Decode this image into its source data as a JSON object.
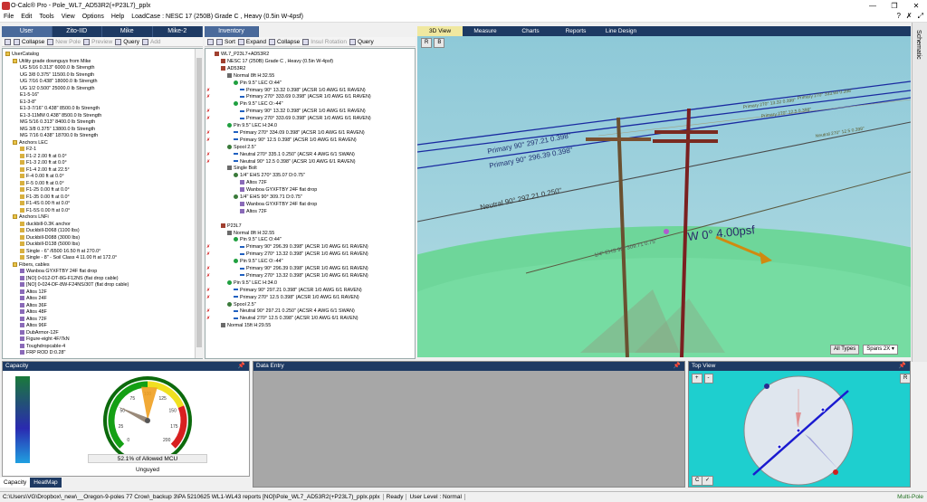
{
  "window": {
    "title": "O-Calc® Pro - Pole_WL7_AD53R2(+P23L7)_pplx",
    "controls": [
      "—",
      "❐",
      "✕"
    ]
  },
  "menu": {
    "items": [
      "File",
      "Edit",
      "Tools",
      "View",
      "Options",
      "Help"
    ],
    "loadcase": "LoadCase : NESC 17 (250B) Grade C , Heavy (0.5in W-4psf)",
    "right": [
      "?",
      "✗",
      "⤢"
    ]
  },
  "catalog": {
    "tabs": [
      "User",
      "Zito-IID",
      "Mike",
      "Mike-2"
    ],
    "toolbar": {
      "collapse": "Collapse",
      "newpole": "New Pole",
      "preview": "Preview",
      "query": "Query",
      "add": "Add"
    },
    "rows": [
      {
        "t": "UserCatalog",
        "lvl": 0,
        "ic": "folder"
      },
      {
        "t": "Utility grade downguys from Mike",
        "lvl": 1,
        "ic": "folder"
      },
      {
        "t": "UG 5/16  0.313\"  6000.0 lb Strength",
        "lvl": 2,
        "ic": ""
      },
      {
        "t": "UG 3/8  0.375\"  11500.0 lb Strength",
        "lvl": 2,
        "ic": ""
      },
      {
        "t": "UG 7/16  0.438\"  18000.0 lb Strength",
        "lvl": 2,
        "ic": ""
      },
      {
        "t": "UG 1/2  0.500\"  25000.0 lb Strength",
        "lvl": 2,
        "ic": ""
      },
      {
        "t": "E1-5-16\"",
        "lvl": 2,
        "ic": ""
      },
      {
        "t": "E1-3-8\"",
        "lvl": 2,
        "ic": ""
      },
      {
        "t": "E1-3-7/16\"  0.438\"  8500.0 lb Strength",
        "lvl": 2,
        "ic": ""
      },
      {
        "t": "E1-3-11MM  0.438\"  8500.0 lb Strength",
        "lvl": 2,
        "ic": ""
      },
      {
        "t": "MG 5/16  0.313\"  8400.0 lb Strength",
        "lvl": 2,
        "ic": ""
      },
      {
        "t": "MG 3/8  0.375\"  13800.0 lb Strength",
        "lvl": 2,
        "ic": ""
      },
      {
        "t": "MG 7/16  0.438\"  18700.0 lb Strength",
        "lvl": 2,
        "ic": ""
      },
      {
        "t": "Anchors LEC",
        "lvl": 1,
        "ic": "folder"
      },
      {
        "t": "F2-1",
        "lvl": 2,
        "ic": "anchor"
      },
      {
        "t": "F1-2 2.00 ft at 0.0°",
        "lvl": 2,
        "ic": "anchor"
      },
      {
        "t": "F1-3 2.00 ft at 0.0°",
        "lvl": 2,
        "ic": "anchor"
      },
      {
        "t": "F1-4 2.00 ft at 22.5°",
        "lvl": 2,
        "ic": "anchor"
      },
      {
        "t": "F-4 0.00 ft at 0.0°",
        "lvl": 2,
        "ic": "anchor"
      },
      {
        "t": "F-5 0.00 ft at 0.0°",
        "lvl": 2,
        "ic": "anchor"
      },
      {
        "t": "F1-25 0.00 ft at 0.0°",
        "lvl": 2,
        "ic": "anchor"
      },
      {
        "t": "F1-35 0.00 ft at 0.0°",
        "lvl": 2,
        "ic": "anchor"
      },
      {
        "t": "F1-4S 0.00 ft at 0.0°",
        "lvl": 2,
        "ic": "anchor"
      },
      {
        "t": "F1-5S 0.00 ft at 0.0°",
        "lvl": 2,
        "ic": "anchor"
      },
      {
        "t": "Anchors LNFi",
        "lvl": 1,
        "ic": "folder"
      },
      {
        "t": "duckbill-0.3K anchor",
        "lvl": 2,
        "ic": "anchor"
      },
      {
        "t": "Duckbill-D068 (1100 lbs)",
        "lvl": 2,
        "ic": "anchor"
      },
      {
        "t": "Duckbill-D088 (3000 lbs)",
        "lvl": 2,
        "ic": "anchor"
      },
      {
        "t": "Duckbill-D138 (5000 lbs)",
        "lvl": 2,
        "ic": "anchor"
      },
      {
        "t": "Single - 6\" /6500 16.50 ft at 270.0°",
        "lvl": 2,
        "ic": "anchor"
      },
      {
        "t": "Single - 8\" - Soil Class 4 11.00 ft at 172.0°",
        "lvl": 2,
        "ic": "anchor"
      },
      {
        "t": "Fibers, cables",
        "lvl": 1,
        "ic": "folder"
      },
      {
        "t": "Wanboa GYXFTBY 24F flat drop",
        "lvl": 2,
        "ic": "fiber"
      },
      {
        "t": "[NO] 0-012-DT-8G-F12NS (flat drop cable)",
        "lvl": 2,
        "ic": "fiber"
      },
      {
        "t": "[NO] 0-024-DF-8W-F24NS/30T (flat drop cable)",
        "lvl": 2,
        "ic": "fiber"
      },
      {
        "t": "Altos 12F",
        "lvl": 2,
        "ic": "fiber"
      },
      {
        "t": "Altos 24F",
        "lvl": 2,
        "ic": "fiber"
      },
      {
        "t": "Altos 36F",
        "lvl": 2,
        "ic": "fiber"
      },
      {
        "t": "Altos 48F",
        "lvl": 2,
        "ic": "fiber"
      },
      {
        "t": "Altos 72F",
        "lvl": 2,
        "ic": "fiber"
      },
      {
        "t": "Altos 96F",
        "lvl": 2,
        "ic": "fiber"
      },
      {
        "t": "DubArmor-12F",
        "lvl": 2,
        "ic": "fiber"
      },
      {
        "t": "Figure-eight 4F/7kN",
        "lvl": 2,
        "ic": "fiber"
      },
      {
        "t": "Toughdropcable-4",
        "lvl": 2,
        "ic": "fiber"
      },
      {
        "t": "FRP ROD  D:0.28\"",
        "lvl": 2,
        "ic": "fiber"
      }
    ]
  },
  "inventory": {
    "tabs": [
      "Inventory"
    ],
    "toolbar": {
      "sort": "Sort",
      "expand": "Expand",
      "collapse": "Collapse",
      "insul": "Insul Rotation",
      "query": "Query"
    },
    "rows": [
      {
        "t": "WL7_P23L7+AD53R2",
        "lvl": 0,
        "ic": "pole"
      },
      {
        "t": "NESC  17 (250B) Grade C , Heavy (0.5in W-4psf)",
        "lvl": 1,
        "ic": "pole"
      },
      {
        "t": "AD53R2",
        "lvl": 1,
        "ic": "pole"
      },
      {
        "t": "Normal 8ft  H:32.55",
        "lvl": 2,
        "ic": "bolt"
      },
      {
        "t": "Pin 9.5\"  LEC  O:44\"",
        "lvl": 3,
        "ic": "pin"
      },
      {
        "t": "Primary 90°  13.32  0.398\"   (ACSR 1/0  AWG 6/1 RAVEN)",
        "lvl": 4,
        "ic": "wire"
      },
      {
        "t": "Primary 270°  333.69  0.398\"   (ACSR 1/0  AWG 6/1 RAVEN)",
        "lvl": 4,
        "ic": "wire"
      },
      {
        "t": "Pin 9.5\"  LEC  O:-44\"",
        "lvl": 3,
        "ic": "pin"
      },
      {
        "t": "Primary 90°  13.32  0.398\"   (ACSR 1/0  AWG 6/1 RAVEN)",
        "lvl": 4,
        "ic": "wire"
      },
      {
        "t": "Primary 270°  333.69  0.398\"   (ACSR 1/0  AWG 6/1 RAVEN)",
        "lvl": 4,
        "ic": "wire"
      },
      {
        "t": "Pin 9.5\"  LEC  H:34.0",
        "lvl": 2,
        "ic": "pin"
      },
      {
        "t": "Primary 270°  334.09  0.398\"   (ACSR 1/0  AWG 6/1 RAVEN)",
        "lvl": 3,
        "ic": "wire"
      },
      {
        "t": "Primary 90°  12.5  0.398\"   (ACSR 1/0  AWG 6/1 RAVEN)",
        "lvl": 3,
        "ic": "wire"
      },
      {
        "t": "Spool 2.5\"",
        "lvl": 2,
        "ic": "spool"
      },
      {
        "t": "Neutral 270°  335.1  0.250\"   (ACSR 4 AWG 6/1 SWAN)",
        "lvl": 3,
        "ic": "wire"
      },
      {
        "t": "Neutral 90°  12.5  0.398\"   (ACSR 1/0  AWG 6/1 RAVEN)",
        "lvl": 3,
        "ic": "wire"
      },
      {
        "t": "Single Bolt",
        "lvl": 2,
        "ic": "bolt"
      },
      {
        "t": "1/4\"  EHS 270°  335.07  D:0.75\"",
        "lvl": 3,
        "ic": "spool"
      },
      {
        "t": "Altos 72F",
        "lvl": 4,
        "ic": "fiber"
      },
      {
        "t": "Wanboa GYXFTBY 24F flat drop",
        "lvl": 4,
        "ic": "fiber"
      },
      {
        "t": "1/4\"  EHS 90°  309.71  D:0.75\"",
        "lvl": 3,
        "ic": "spool"
      },
      {
        "t": "Wanboa GYXFTBY 24F flat drop",
        "lvl": 4,
        "ic": "fiber"
      },
      {
        "t": "Altos 72F",
        "lvl": 4,
        "ic": "fiber"
      },
      {
        "t": "",
        "lvl": 0,
        "ic": ""
      },
      {
        "t": "P23L7",
        "lvl": 1,
        "ic": "pole"
      },
      {
        "t": "Normal 8ft  H:32.55",
        "lvl": 2,
        "ic": "bolt"
      },
      {
        "t": "Pin 9.5\"  LEC  O:44\"",
        "lvl": 3,
        "ic": "pin"
      },
      {
        "t": "Primary 90°  296.39  0.398\"   (ACSR 1/0  AWG 6/1 RAVEN)",
        "lvl": 4,
        "ic": "wire"
      },
      {
        "t": "Primary 270°  13.32  0.398\"   (ACSR 1/0  AWG 6/1 RAVEN)",
        "lvl": 4,
        "ic": "wire"
      },
      {
        "t": "Pin 9.5\"  LEC  O:-44\"",
        "lvl": 3,
        "ic": "pin"
      },
      {
        "t": "Primary 90°  296.39  0.398\"   (ACSR 1/0  AWG 6/1 RAVEN)",
        "lvl": 4,
        "ic": "wire"
      },
      {
        "t": "Primary 270°  13.32  0.398\"   (ACSR 1/0  AWG 6/1 RAVEN)",
        "lvl": 4,
        "ic": "wire"
      },
      {
        "t": "Pin 9.5\"  LEC  H:34.0",
        "lvl": 2,
        "ic": "pin"
      },
      {
        "t": "Primary 90°  297.21  0.398\"   (ACSR 1/0  AWG 6/1 RAVEN)",
        "lvl": 3,
        "ic": "wire"
      },
      {
        "t": "Primary 270°  12.5  0.398\"   (ACSR 1/0  AWG 6/1 RAVEN)",
        "lvl": 3,
        "ic": "wire"
      },
      {
        "t": "Spool 2.5\"",
        "lvl": 2,
        "ic": "spool"
      },
      {
        "t": "Neutral 90°  297.21  0.250\"   (ACSR 4 AWG 6/1 SWAN)",
        "lvl": 3,
        "ic": "wire"
      },
      {
        "t": "Neutral 270°  12.5  0.398\"   (ACSR 1/0  AWG 6/1 RAVEN)",
        "lvl": 3,
        "ic": "wire"
      },
      {
        "t": "Normal 15ft  H:29.55",
        "lvl": 1,
        "ic": "bolt"
      }
    ]
  },
  "view3d": {
    "tabs": [
      "3D View",
      "Measure",
      "Charts",
      "Reports",
      "Line Design"
    ],
    "labels": {
      "primary1": "Primary 90° 297.21 0.398\"",
      "primary2": "Primary 90° 296.39 0.398\"",
      "neutral": "Neutral 90° 297.21 0.250\"",
      "ehs": "1/4\" EHS 90° 309.71 0.75\"",
      "wind": "W 0°  4.00psf",
      "far1": "Primary 270° 13.32 0.398\"",
      "far2": "Primary 270° 12.5 0.398\"",
      "far3": "Primary 270° 333.69 0.398\"",
      "far4": "Neutral 270° 12.5 0.398\""
    },
    "buttons": {
      "alltypes": "All Types",
      "spans": "Spans 2X"
    },
    "corner": [
      "R",
      "B"
    ]
  },
  "capacity": {
    "title": "Capacity",
    "percent": 52.1,
    "caption": "52.1% of Allowed MCU",
    "status": "Unguyed",
    "ticks": [
      "0",
      "25",
      "50",
      "75",
      "100",
      "125",
      "150",
      "175",
      "200"
    ],
    "colors": {
      "green": "#14a014",
      "yellow": "#f0e020",
      "red": "#d82020",
      "needle": "#9a8a7a",
      "pointer": "#f0a020"
    }
  },
  "dataentry": {
    "title": "Data Entry"
  },
  "topview": {
    "title": "Top View",
    "buttons": [
      "+",
      "-"
    ],
    "right": "R",
    "bottom": [
      "C",
      "✓"
    ]
  },
  "bottomtabs": [
    "Capacity",
    "HeatMap"
  ],
  "status": {
    "path": "C:\\Users\\VG\\Dropbox\\_new\\__Oregon-9-poles 77 Crow\\_backup 3\\PA 5210625 WL1-WL43 reports [NO]\\Pole_WL7_AD53R2(+P23L7)_pplx.pplx",
    "ready": "Ready",
    "level": "User Level : Normal",
    "mode": "Multi-Pole"
  },
  "sidetab": "Schematic"
}
